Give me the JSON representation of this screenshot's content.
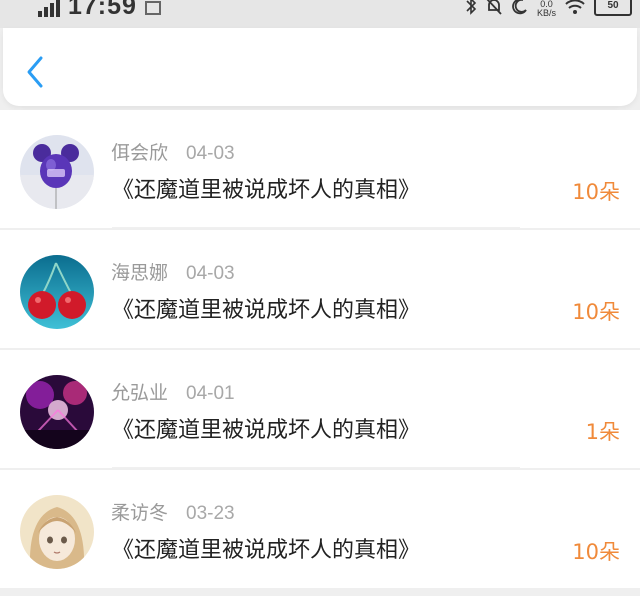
{
  "status_bar": {
    "time": "17:59",
    "network_speed_unit": "KB/s",
    "battery_level": "50"
  },
  "nav": {
    "back_icon": "chevron-left-icon",
    "accent_color": "#2a9df4"
  },
  "gift_list": [
    {
      "name": "佴会欣",
      "date": "04-03",
      "title": "《还魔道里被说成坏人的真相》",
      "amount": "10朵",
      "avatar": "purple-balloon-avatar"
    },
    {
      "name": "海思娜",
      "date": "04-03",
      "title": "《还魔道里被说成坏人的真相》",
      "amount": "10朵",
      "avatar": "cherries-avatar"
    },
    {
      "name": "允弘业",
      "date": "04-01",
      "title": "《还魔道里被说成坏人的真相》",
      "amount": "1朵",
      "avatar": "concert-avatar"
    },
    {
      "name": "柔访冬",
      "date": "03-23",
      "title": "《还魔道里被说成坏人的真相》",
      "amount": "10朵",
      "avatar": "anime-girl-avatar"
    }
  ],
  "colors": {
    "amount": "#f08a3a",
    "name": "#9a9a9a",
    "title": "#222222"
  }
}
